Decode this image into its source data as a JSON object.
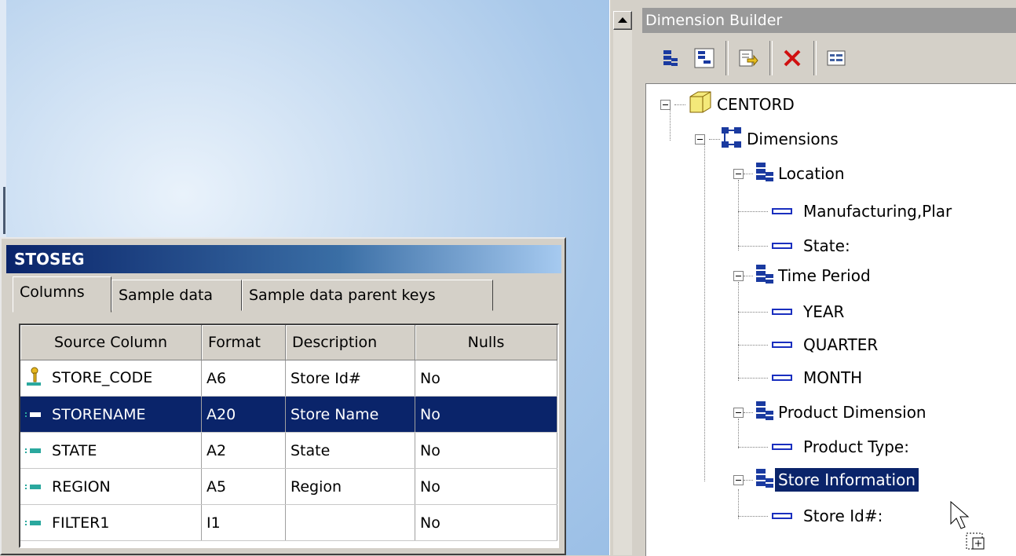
{
  "dimension_builder": {
    "title": "Dimension Builder",
    "toolbar": [
      "hierarchy-add-icon",
      "hierarchy-edit-icon",
      "export-icon",
      "delete-icon",
      "properties-icon"
    ],
    "tree": {
      "root": "CENTORD",
      "dimensions": "Dimensions",
      "location": "Location",
      "loc_field1": "Manufacturing,Plar",
      "loc_field2": "State:",
      "time": "Time Period",
      "time_field1": "YEAR",
      "time_field2": "QUARTER",
      "time_field3": "MONTH",
      "product": "Product Dimension",
      "product_field1": "Product Type:",
      "store": "Store Information",
      "store_field1": "Store Id#:"
    }
  },
  "segment_window": {
    "title": "STOSEG",
    "tabs": [
      "Columns",
      "Sample data",
      "Sample data parent keys"
    ],
    "columns": [
      "Source Column",
      "Format",
      "Description",
      "Nulls"
    ],
    "rows": [
      {
        "name": "STORE_CODE",
        "format": "A6",
        "description": "Store Id#",
        "nulls": "No"
      },
      {
        "name": "STORENAME",
        "format": "A20",
        "description": "Store Name",
        "nulls": "No"
      },
      {
        "name": "STATE",
        "format": "A2",
        "description": "State",
        "nulls": "No"
      },
      {
        "name": "REGION",
        "format": "A5",
        "description": "Region",
        "nulls": "No"
      },
      {
        "name": "FILTER1",
        "format": "I1",
        "description": "",
        "nulls": "No"
      }
    ]
  }
}
